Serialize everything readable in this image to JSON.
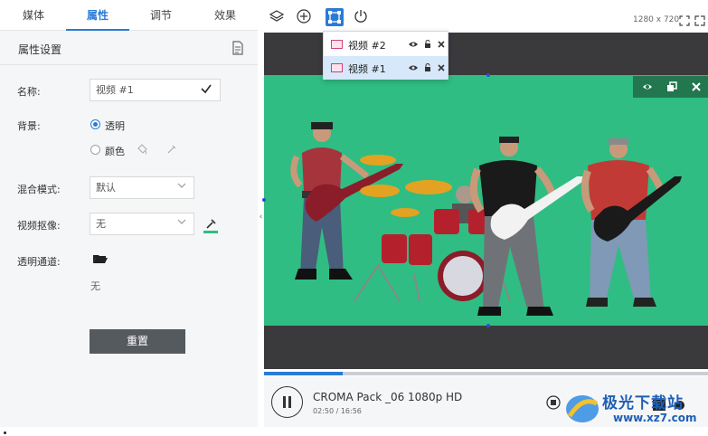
{
  "tabs": [
    {
      "label": "媒体"
    },
    {
      "label": "属性"
    },
    {
      "label": "调节"
    },
    {
      "label": "效果"
    }
  ],
  "panel": {
    "title": "属性设置",
    "name_label": "名称:",
    "name_value": "视频 #1",
    "bg_label": "背景:",
    "bg_transparent": "透明",
    "bg_color": "颜色",
    "blend_label": "混合模式:",
    "blend_value": "默认",
    "key_label": "视频抠像:",
    "key_value": "无",
    "alpha_label": "透明通道:",
    "alpha_value": "无",
    "reset": "重置"
  },
  "toolbar": {
    "resolution": "1280 x 720"
  },
  "layers": [
    {
      "name": "视频 #2",
      "selected": false
    },
    {
      "name": "视频 #1",
      "selected": true
    }
  ],
  "player": {
    "title": "CROMA Pack _06 1080p HD",
    "time": "02:50 / 16:56",
    "progress": 0.177
  },
  "watermark": {
    "line1": "极光下载站",
    "line2": "www.xz7.com"
  },
  "colors": {
    "accent": "#2a7bd6",
    "chroma": "#2fbd83"
  }
}
